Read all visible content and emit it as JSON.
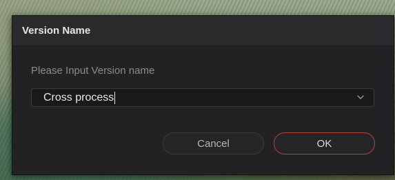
{
  "dialog": {
    "title": "Version Name",
    "prompt": "Please Input Version name",
    "version_select": {
      "value": "Cross process",
      "chevron_icon": "chevron-down-icon"
    },
    "buttons": {
      "cancel_label": "Cancel",
      "ok_label": "OK"
    }
  },
  "colors": {
    "dialog_bg": "#222224",
    "titlebar_bg": "#2b2b2d",
    "ok_border_accent": "#b9423c"
  }
}
